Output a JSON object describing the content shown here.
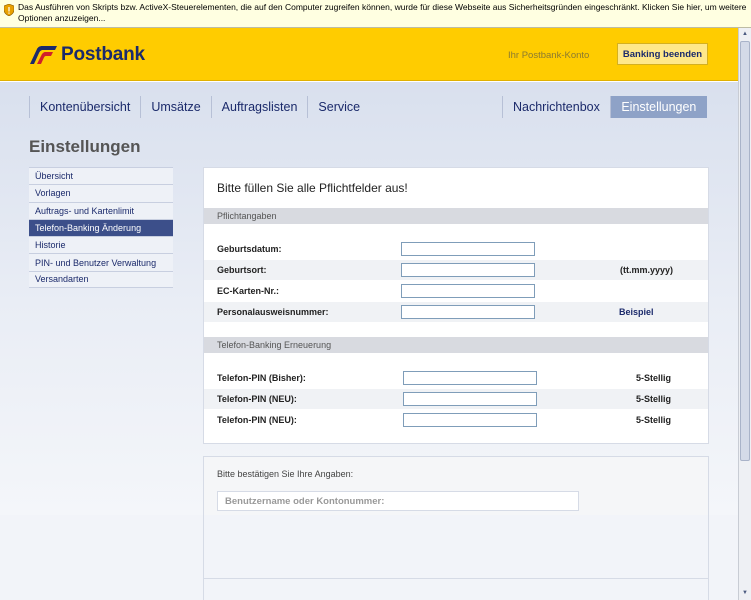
{
  "infobar": {
    "text": "Das Ausführen von Skripts bzw. ActiveX-Steuerelementen, die auf den Computer zugreifen können, wurde für diese Webseite aus Sicherheitsgründen eingeschränkt. Klicken Sie hier, um weitere Optionen anzuzeigen..."
  },
  "header": {
    "brand": "Postbank",
    "account_link": "Ihr Postbank-Konto",
    "end_button": "Banking beenden"
  },
  "nav": {
    "left": [
      "Kontenübersicht",
      "Umsätze",
      "Auftragslisten",
      "Service"
    ],
    "right": [
      "Nachrichtenbox",
      "Einstellungen"
    ],
    "active": "Einstellungen"
  },
  "page_title": "Einstellungen",
  "sidebar": {
    "items": [
      "Übersicht",
      "Vorlagen",
      "Auftrags- und Kartenlimit",
      "Telefon-Banking Änderung",
      "Historie",
      "PIN- und Benutzer Verwaltung",
      "Versandarten"
    ],
    "active": "Telefon-Banking Änderung"
  },
  "form": {
    "heading": "Bitte füllen Sie alle Pflichtfelder aus!",
    "section1": "Pflichtangaben",
    "fields1": [
      {
        "label": "Geburtsdatum:",
        "value": "",
        "hint": ""
      },
      {
        "label": "Geburtsort:",
        "value": "",
        "hint": "(tt.mm.yyyy)"
      },
      {
        "label": "EC-Karten-Nr.:",
        "value": "",
        "hint": ""
      },
      {
        "label": "Personalausweisnummer:",
        "value": "",
        "hint": "Beispiel"
      }
    ],
    "section2": "Telefon-Banking Erneuerung",
    "fields2": [
      {
        "label": "Telefon-PIN (Bisher):",
        "value": "",
        "hint": "5-Stellig"
      },
      {
        "label": "Telefon-PIN (NEU):",
        "value": "",
        "hint": "5-Stellig"
      },
      {
        "label": "Telefon-PIN (NEU):",
        "value": "",
        "hint": "5-Stellig"
      }
    ]
  },
  "confirm": {
    "text": "Bitte bestätigen Sie Ihre Angaben:",
    "placeholder": "Benutzername oder Kontonummer:"
  },
  "colors": {
    "brand_yellow": "#ffcc00",
    "brand_blue": "#1b2a6b",
    "nav_active": "#8ea2c7",
    "sidebar_active": "#3c4f8a"
  }
}
